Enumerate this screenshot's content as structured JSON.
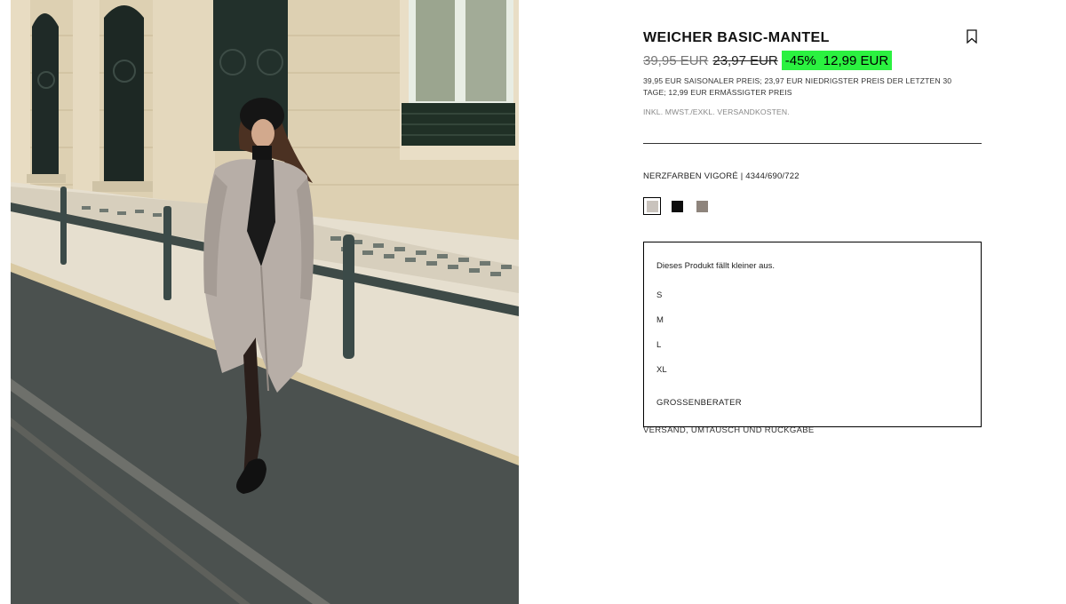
{
  "product": {
    "title": "WEICHER BASIC-MANTEL",
    "bookmark_icon": "bookmark-icon",
    "price": {
      "original": "39,95 EUR",
      "lowest": "23,97 EUR",
      "discount": "-45%",
      "current": "12,99 EUR",
      "highlight_color": "#2bf140",
      "description": "39,95 EUR SAISONALER PREIS; 23,97 EUR NIEDRIGSTER PREIS DER LETZTEN 30 TAGE; 12,99 EUR ERMÄSSIGTER PREIS"
    },
    "tax_note": "INKL. MWST./EXKL. VERSANDKOSTEN.",
    "color_line": "NERZFARBEN VIGORÉ | 4344/690/722",
    "swatches": [
      {
        "color": "#c9c3bd",
        "selected": true
      },
      {
        "color": "#0d0d0d",
        "selected": false
      },
      {
        "color": "#8e847c",
        "selected": false
      }
    ],
    "size_selector": {
      "fit_note": "Dieses Produkt fällt kleiner aus.",
      "sizes": [
        "S",
        "M",
        "L",
        "XL"
      ],
      "guide_label": "GROSSENBERATER"
    },
    "shipping_label": "VERSAND, UMTAUSCH UND RÜCKGABE"
  }
}
